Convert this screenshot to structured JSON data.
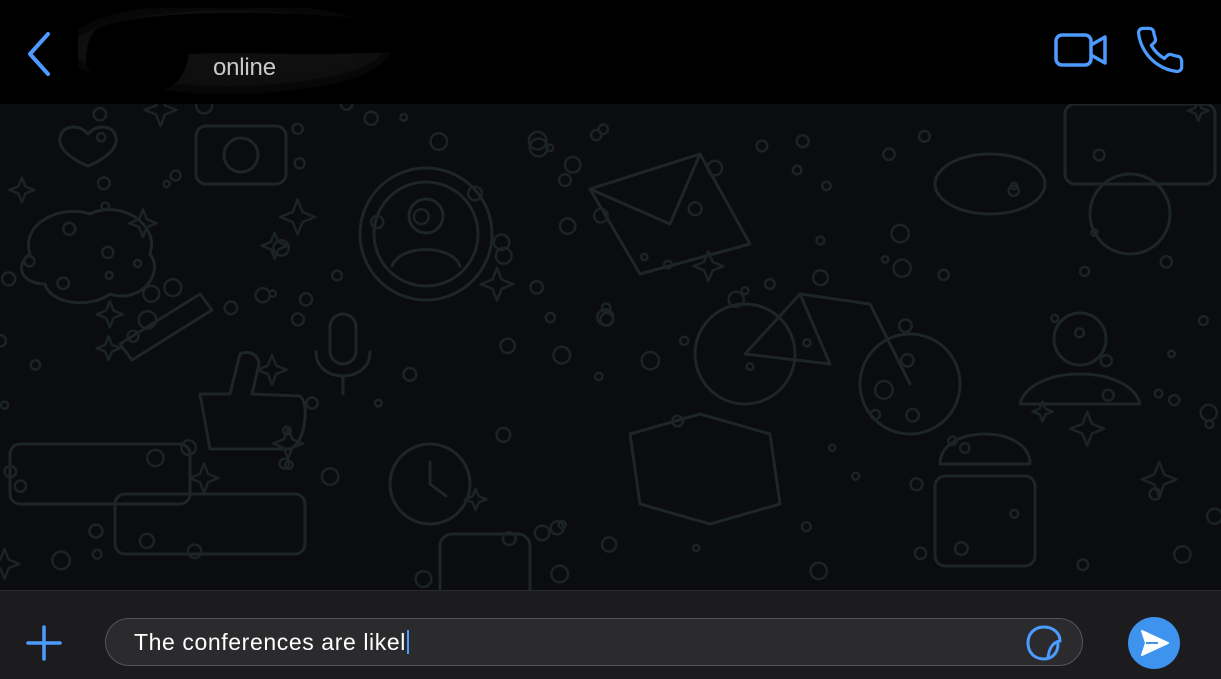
{
  "header": {
    "contact_status": "online",
    "icons": {
      "back": "chevron-left-icon",
      "video": "video-camera-icon",
      "call": "phone-icon"
    }
  },
  "composer": {
    "message_text": "The conferences are likel",
    "icons": {
      "attach": "plus-icon",
      "sticker": "sticker-icon",
      "send": "send-arrow-icon"
    }
  },
  "colors": {
    "accent": "#4c9bff",
    "send_button": "#3d93ee",
    "background": "#000000",
    "composer_bg": "#1c1c1e",
    "input_bg": "#2b2b2d"
  }
}
